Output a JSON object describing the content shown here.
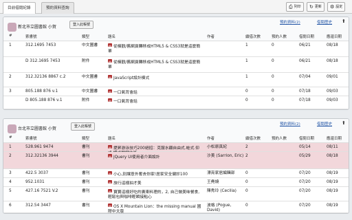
{
  "tabs": [
    "目前借閱紀錄",
    "預約資料查詢"
  ],
  "toolbar": {
    "print": "列印",
    "refresh": "更新",
    "settings": "設定"
  },
  "columns": [
    "#",
    "索書號",
    "類型",
    "題名",
    "作者",
    "續借次數",
    "預約人數",
    "借閱日期",
    "應還日期"
  ],
  "panels": [
    {
      "library": "新北市立圖書館 小賀",
      "login": "登入此帳號",
      "reserve_link": "預約資料(2)",
      "history_link": "借閱歷史",
      "rows": [
        {
          "no": "1",
          "call": "312.1695 7453",
          "type": "中文圖書",
          "title": "從橫觀/舊網頁轉移成HTML5 & CSS3就是這麼簡單",
          "author": "",
          "renew": "1",
          "holds": "0",
          "borrow": "06/21",
          "due": "08/18"
        },
        {
          "no": "",
          "call": "D 312.1695 7453",
          "type": "附件",
          "title": "從橫觀/舊網頁轉移成HTML5 & CSS3就是這麼簡單",
          "author": "",
          "renew": "1",
          "holds": "0",
          "borrow": "06/21",
          "due": "08/18"
        },
        {
          "no": "2",
          "call": "312.32136 8867 c.2",
          "type": "中文圖書",
          "title": "JavaScript設計模式",
          "author": "",
          "renew": "1",
          "holds": "0",
          "borrow": "07/04",
          "due": "09/01"
        },
        {
          "no": "3",
          "call": "805.188 876 v.1",
          "type": "中文圖書",
          "title": "一口氣背會話",
          "author": "",
          "renew": "0",
          "holds": "0",
          "borrow": "07/18",
          "due": "09/03"
        },
        {
          "no": "",
          "call": "D 805.188 876 v.1",
          "type": "附件",
          "title": "一口氣背會話",
          "author": "",
          "renew": "0",
          "holds": "0",
          "borrow": "07/18",
          "due": "09/03"
        }
      ]
    },
    {
      "library": "台北市立圖書館 小賀",
      "login": "登入此帳號",
      "reserve_link": "預約資料(2)",
      "history_link": "借閱歷史",
      "rows": [
        {
          "no": "1",
          "call": "528.961 9474",
          "type": "書刊",
          "title": "提昇游泳技巧200絕招：克服水顧自由式.蛙式.仰式.蝶式關鍵技術",
          "author": "小松原真紀",
          "renew": "2",
          "holds": "",
          "borrow": "05/14",
          "due": "08/11"
        },
        {
          "no": "2",
          "call": "312.32136 3944",
          "type": "書刊",
          "title": "jQuery UI使用者介面設計",
          "author": "沙美 (Sarrion, Eric)",
          "renew": "2",
          "holds": "",
          "borrow": "05/29",
          "due": "08/18"
        },
        {
          "no": "3",
          "call": "422.5 3037",
          "type": "書刊",
          "title": "小心,別讓意外奪去你家!居家安全健診100",
          "author": "漂亮家居編輯部",
          "renew": "0",
          "holds": "",
          "borrow": "07/20",
          "due": "08/19"
        },
        {
          "no": "4",
          "call": "952.1031",
          "type": "書刊",
          "title": "旅行這樣拍才美",
          "author": "王堯燒",
          "renew": "0",
          "holds": "",
          "borrow": "07/20",
          "due": "08/19"
        },
        {
          "no": "5",
          "call": "427.16 7521 V.2",
          "type": "書刊",
          "title": "寶寶這樣好吃的廣東料理的，2, 自己做美味餐食,輕鬆包與咖啡輕瞬接點心",
          "author": "陳秀玲 (Cecilia)",
          "renew": "0",
          "holds": "",
          "borrow": "07/20",
          "due": "08/19"
        },
        {
          "no": "6",
          "call": "312.54 3447",
          "type": "書刊",
          "title": "OS X Mountain Lion：the missing manual 國際中文版",
          "author": "波格 (Pogue, David)",
          "renew": "0",
          "holds": "",
          "borrow": "07/20",
          "due": "08/19"
        }
      ]
    }
  ]
}
